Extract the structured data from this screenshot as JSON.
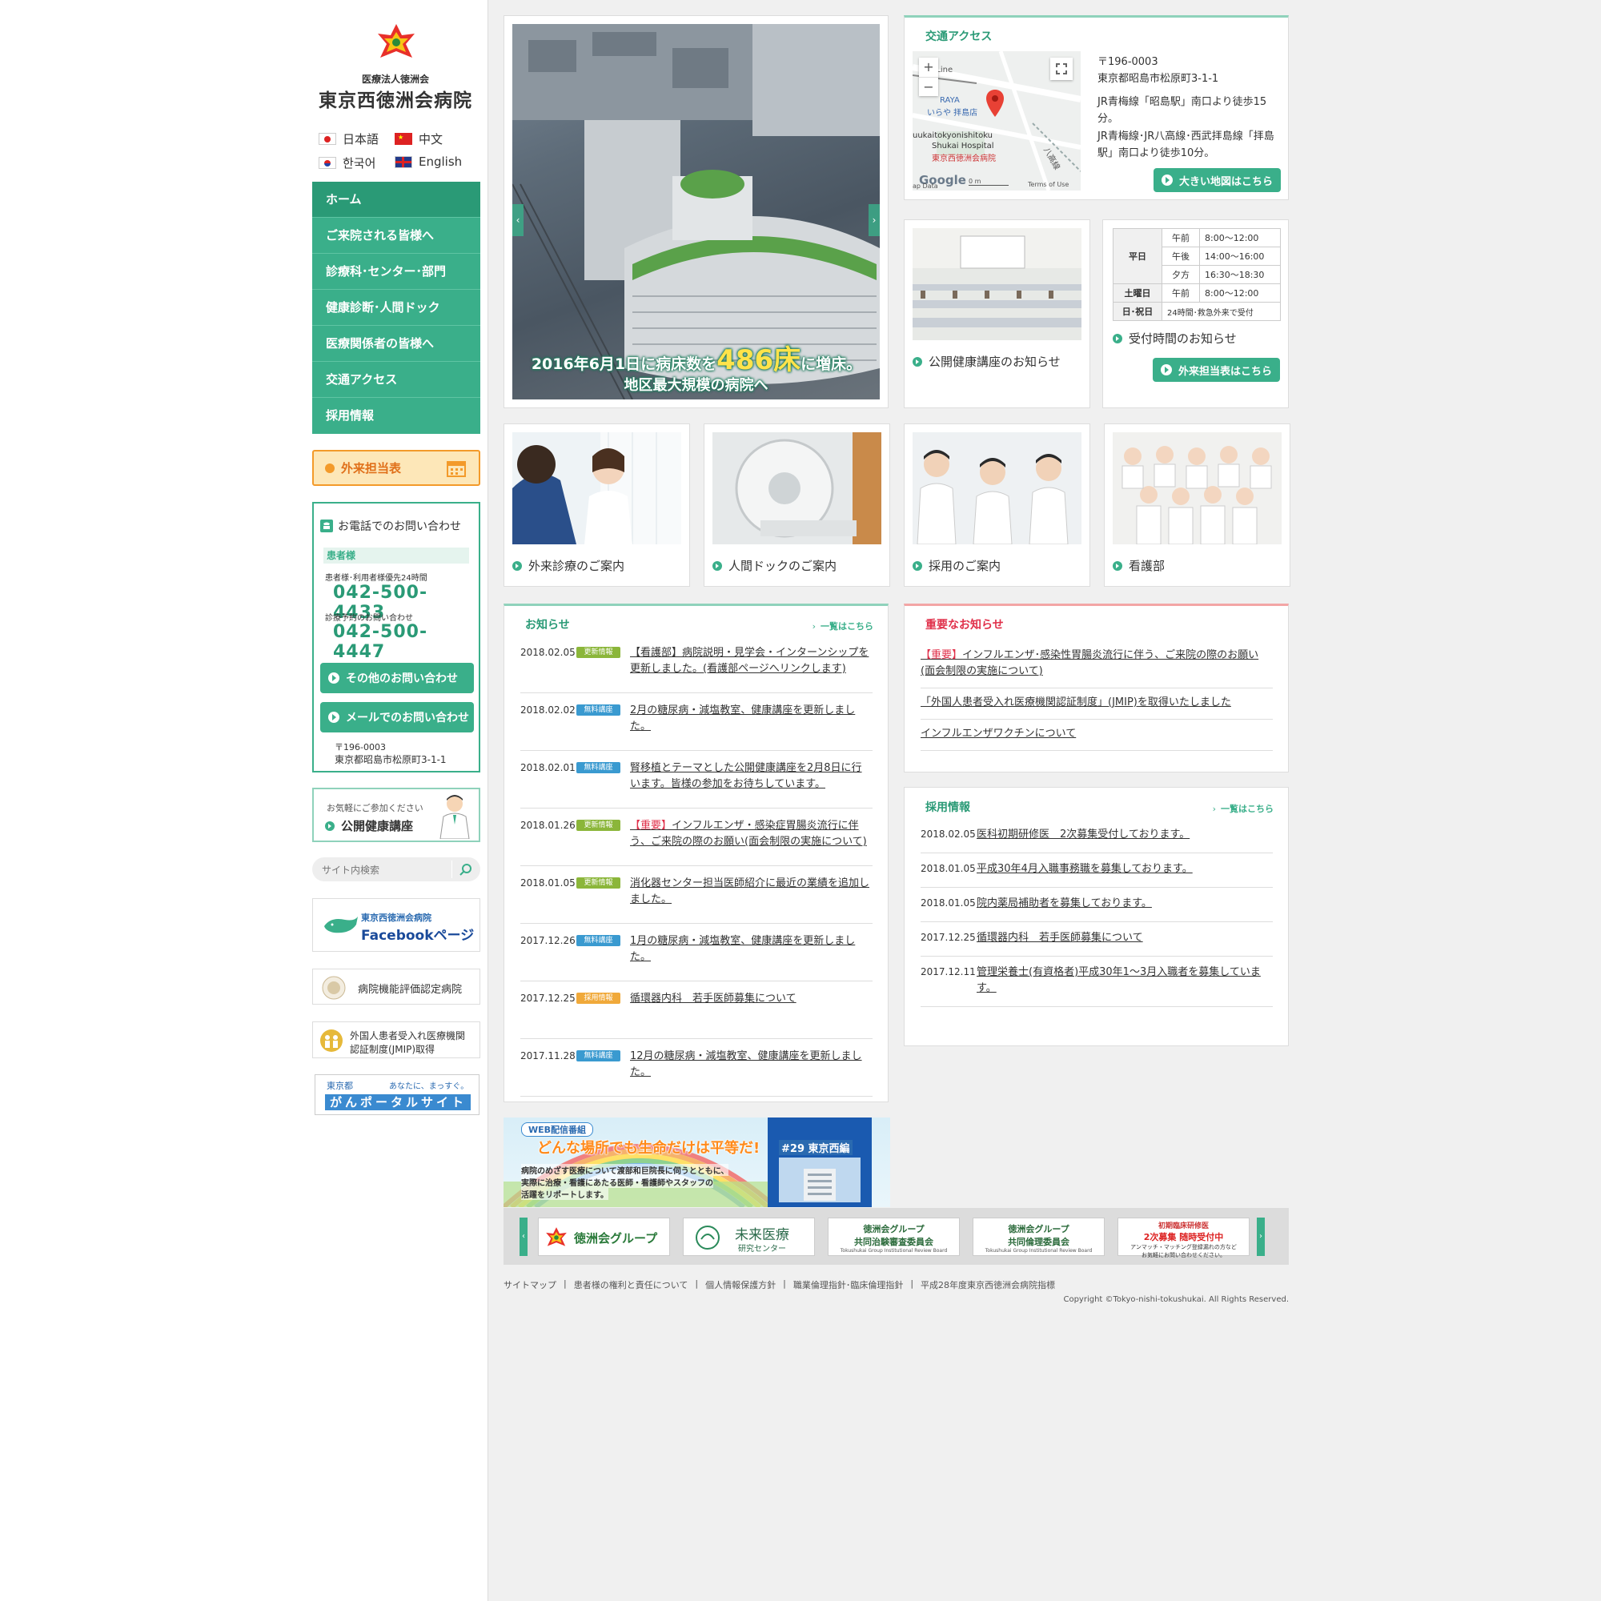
{
  "logo": {
    "org": "医療法人徳洲会",
    "name": "東京西徳洲会病院"
  },
  "languages": [
    {
      "label": "日本語",
      "flag": "jp"
    },
    {
      "label": "中文",
      "flag": "cn"
    },
    {
      "label": "한국어",
      "flag": "kr"
    },
    {
      "label": "English",
      "flag": "uk"
    }
  ],
  "nav": [
    "ホーム",
    "ご来院される皆様へ",
    "診療科･センター･部門",
    "健康診断･人間ドック",
    "医療関係者の皆様へ",
    "交通アクセス",
    "採用情報"
  ],
  "schedule_button": "外来担当表",
  "phone": {
    "title": "お電話でのお問い合わせ",
    "patient_label": "患者様",
    "line1_label": "患者様･利用者様優先24時間",
    "line1_number": "042-500-4433",
    "line2_label": "診療予約のお問い合わせ",
    "line2_number": "042-500-4447",
    "btn_other": "その他のお問い合わせ",
    "btn_mail": "メールでのお問い合わせ",
    "postal": "〒196-0003",
    "address": "東京都昭島市松原町3-1-1"
  },
  "lecture_banner": {
    "small": "お気軽にご参加ください",
    "main": "公開健康講座"
  },
  "search": {
    "placeholder": "サイト内検索"
  },
  "facebook": {
    "top": "東京西徳洲会病院",
    "main": "Facebookページ"
  },
  "evaluation": {
    "label": "病院機能評価認定病院"
  },
  "jmip": {
    "line1": "外国人患者受入れ医療機関",
    "line2": "認証制度(JMIP)取得"
  },
  "cancer": {
    "top_left": "東京都",
    "top_right": "あなたに、まっすぐ。",
    "main": "がんポータルサイト"
  },
  "hero": {
    "line1": "2016年6月1日に病床数を",
    "big": "486床",
    "line1b": "に増床。",
    "line2": "地区最大規模の病院へ"
  },
  "access": {
    "title": "交通アクセス",
    "postal": "〒196-0003",
    "address": "東京都昭島市松原町3-1-1",
    "route1": "JR青梅線「昭島駅」南口より徒歩15分。",
    "route2": "JR青梅線･JR八高線･西武拝島線「拝島駅」南口より徒歩10分。",
    "map_button": "大きい地図はこちら",
    "map_plus": "+",
    "map_minus": "−",
    "map_labels": {
      "line": "o Line",
      "shop": "RAYA",
      "shop2": "いらや 拝島店",
      "hosp_en1": "uukaitokyonishitoku",
      "hosp_en2": "Shukai Hospital",
      "hosp_jp": "東京西徳洲会病院",
      "google": "Google",
      "terms": "Terms of Use",
      "mapdata": "ap Data",
      "scale": "0 m",
      "road": "八高線"
    }
  },
  "lecture_card": {
    "label": "公開健康講座のお知らせ"
  },
  "hours": {
    "rows": [
      {
        "day": "平日",
        "slot": "午前",
        "time": "8:00〜12:00"
      },
      {
        "day": "",
        "slot": "午後",
        "time": "14:00〜16:00"
      },
      {
        "day": "",
        "slot": "夕方",
        "time": "16:30〜18:30"
      },
      {
        "day": "土曜日",
        "slot": "午前",
        "time": "8:00〜12:00"
      },
      {
        "day": "日･祝日",
        "slot": "",
        "time": "24時間･救急外来で受付"
      }
    ],
    "label": "受付時間のお知らせ",
    "button": "外来担当表はこちら"
  },
  "tiles": [
    "外来診療のご案内",
    "人間ドックのご案内",
    "採用のご案内",
    "看護部"
  ],
  "news": {
    "title": "お知らせ",
    "more": "一覧はこちら",
    "items": [
      {
        "date": "2018.02.05",
        "badge": "更新情報",
        "kind": "update",
        "text": "【看護部】病院説明・見学会・インターンシップを更新しました。(看護部ページへリンクします)"
      },
      {
        "date": "2018.02.02",
        "badge": "無料講座",
        "kind": "free",
        "text": "2月の糖尿病・減塩教室、健康講座を更新しました。"
      },
      {
        "date": "2018.02.01",
        "badge": "無料講座",
        "kind": "free",
        "text": "腎移植とテーマとした公開健康講座を2月8日に行います。皆様の参加をお待ちしています。"
      },
      {
        "date": "2018.01.26",
        "badge": "更新情報",
        "kind": "update",
        "prefix": "【重要】",
        "text": "インフルエンザ・感染症胃腸炎流行に伴う、ご来院の際のお願い(面会制限の実施について)"
      },
      {
        "date": "2018.01.05",
        "badge": "更新情報",
        "kind": "update",
        "text": "消化器センター担当医師紹介に最近の業績を追加しました。"
      },
      {
        "date": "2017.12.26",
        "badge": "無料講座",
        "kind": "free",
        "text": "1月の糖尿病・減塩教室、健康講座を更新しました。"
      },
      {
        "date": "2017.12.25",
        "badge": "採用情報",
        "kind": "recruit",
        "text": "循環器内科　若手医師募集について"
      },
      {
        "date": "2017.11.28",
        "badge": "無料講座",
        "kind": "free",
        "text": "12月の糖尿病・減塩教室、健康講座を更新しました。"
      }
    ]
  },
  "important": {
    "title": "重要なお知らせ",
    "items": [
      {
        "prefix": "【重要】",
        "text": "インフルエンザ･感染性胃腸炎流行に伴う、ご来院の際のお願い(面会制限の実施について)"
      },
      {
        "prefix": "",
        "text": "「外国人患者受入れ医療機関認証制度」(JMIP)を取得いたしました"
      },
      {
        "prefix": "",
        "text": "インフルエンザワクチンについて"
      }
    ]
  },
  "recruit": {
    "title": "採用情報",
    "more": "一覧はこちら",
    "items": [
      {
        "date": "2018.02.05",
        "text": "医科初期研修医　2次募集受付しております。"
      },
      {
        "date": "2018.01.05",
        "text": "平成30年4月入職事務職を募集しております。"
      },
      {
        "date": "2018.01.05",
        "text": "院内薬局補助者を募集しております。"
      },
      {
        "date": "2017.12.25",
        "text": "循環器内科　若手医師募集について"
      },
      {
        "date": "2017.12.11",
        "text": "管理栄養士(有資格者)平成30年1～3月入職者を募集しています。"
      }
    ]
  },
  "web_banner": {
    "tag": "WEB配信番組",
    "title": "どんな場所でも生命だけは平等だ!",
    "episode": "#29 東京西編",
    "desc1": "病院のめざす医療について渡部和巨院長に伺うとともに、",
    "desc2": "実際に治療・看護にあたる医師・看護師やスタッフの",
    "desc3": "活躍をリポートします。"
  },
  "partners": [
    {
      "main": "徳洲会グループ"
    },
    {
      "main": "未来医療",
      "sub": "研究センター"
    },
    {
      "main": "徳洲会グループ",
      "sub": "共同治験審査委員会",
      "en": "Tokushukai Group Institutional Review Board"
    },
    {
      "main": "徳洲会グループ",
      "sub": "共同倫理委員会",
      "en": "Tokushukai Group Institutional Review Board"
    },
    {
      "main": "初期臨床研修医",
      "sub": "2次募集 随時受付中",
      "note1": "アンマッチ・マッチング登録漏れの方など",
      "note2": "お気軽にお問い合わせください。"
    }
  ],
  "footer": {
    "links": [
      "サイトマップ",
      "患者様の権利と責任について",
      "個人情報保護方針",
      "職業倫理指針･臨床倫理指針",
      "平成28年度東京西徳洲会病院指標"
    ],
    "copyright": "Copyright ©Tokyo-nishi-tokushukai. All Rights Reserved."
  },
  "colors": {
    "green": "#3aaf8a",
    "orange": "#f39a2a",
    "red": "#e0304a",
    "badge_update": "#8bb63a",
    "badge_free": "#3a9ad0",
    "badge_recruit": "#f0a93a"
  }
}
